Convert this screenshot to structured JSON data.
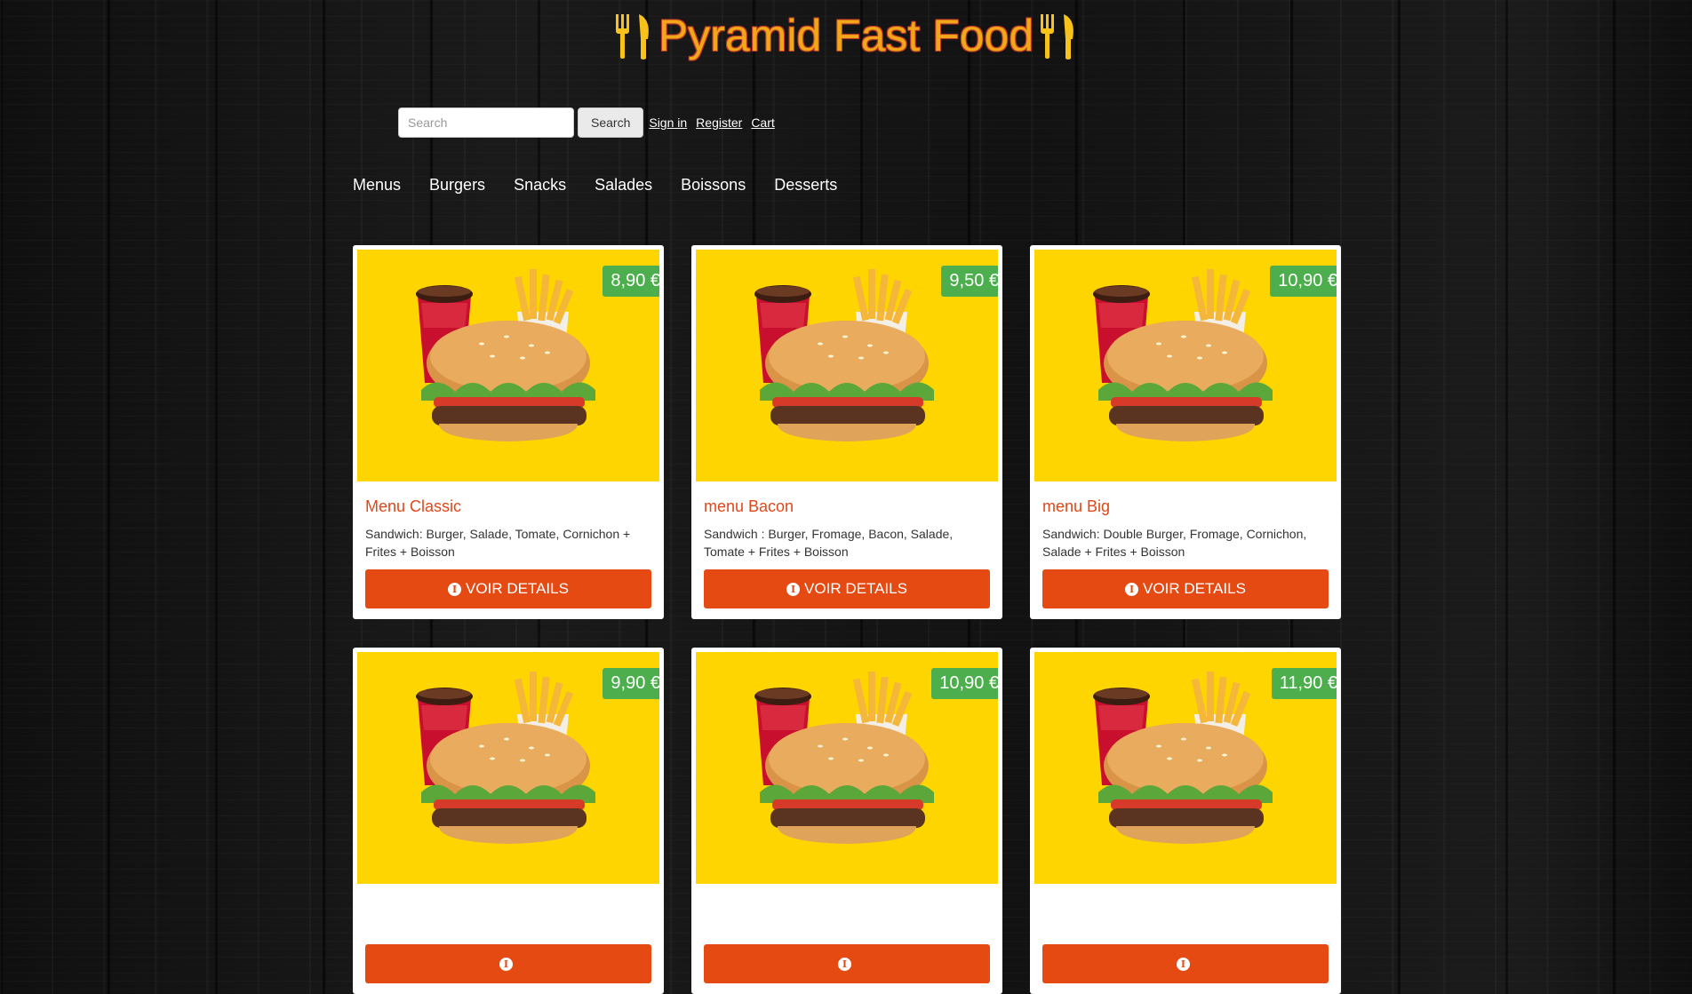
{
  "brand": {
    "title": "Pyramid Fast Food"
  },
  "search": {
    "placeholder": "Search",
    "button_label": "Search"
  },
  "account_links": [
    {
      "label": "Sign in"
    },
    {
      "label": "Register"
    },
    {
      "label": "Cart"
    }
  ],
  "nav": [
    {
      "label": "Menus"
    },
    {
      "label": "Burgers"
    },
    {
      "label": "Snacks"
    },
    {
      "label": "Salades"
    },
    {
      "label": "Boissons"
    },
    {
      "label": "Desserts"
    }
  ],
  "products": [
    {
      "title": "Menu Classic",
      "price": "8,90 €",
      "description": "Sandwich: Burger, Salade, Tomate, Cornichon + Frites + Boisson",
      "button_label": "VOIR DETAILS",
      "image_icon": "burger-menu-image"
    },
    {
      "title": "menu Bacon",
      "price": "9,50 €",
      "description": "Sandwich : Burger, Fromage, Bacon, Salade, Tomate + Frites + Boisson",
      "button_label": "VOIR DETAILS",
      "image_icon": "burger-menu-image"
    },
    {
      "title": "menu Big",
      "price": "10,90 €",
      "description": "Sandwich: Double Burger, Fromage, Cornichon, Salade + Frites + Boisson",
      "button_label": "VOIR DETAILS",
      "image_icon": "burger-menu-image"
    },
    {
      "title": "",
      "price": "9,90 €",
      "description": "",
      "button_label": "",
      "image_icon": "burger-menu-image"
    },
    {
      "title": "",
      "price": "10,90 €",
      "description": "",
      "button_label": "",
      "image_icon": "burger-menu-image"
    },
    {
      "title": "",
      "price": "11,90 €",
      "description": "",
      "button_label": "",
      "image_icon": "burger-menu-image"
    }
  ],
  "colors": {
    "brand_title": "#f0a818",
    "accent_button": "#e44a12",
    "price_badge": "#4cae4c",
    "image_background": "#ffd500",
    "product_title": "#e04818"
  }
}
